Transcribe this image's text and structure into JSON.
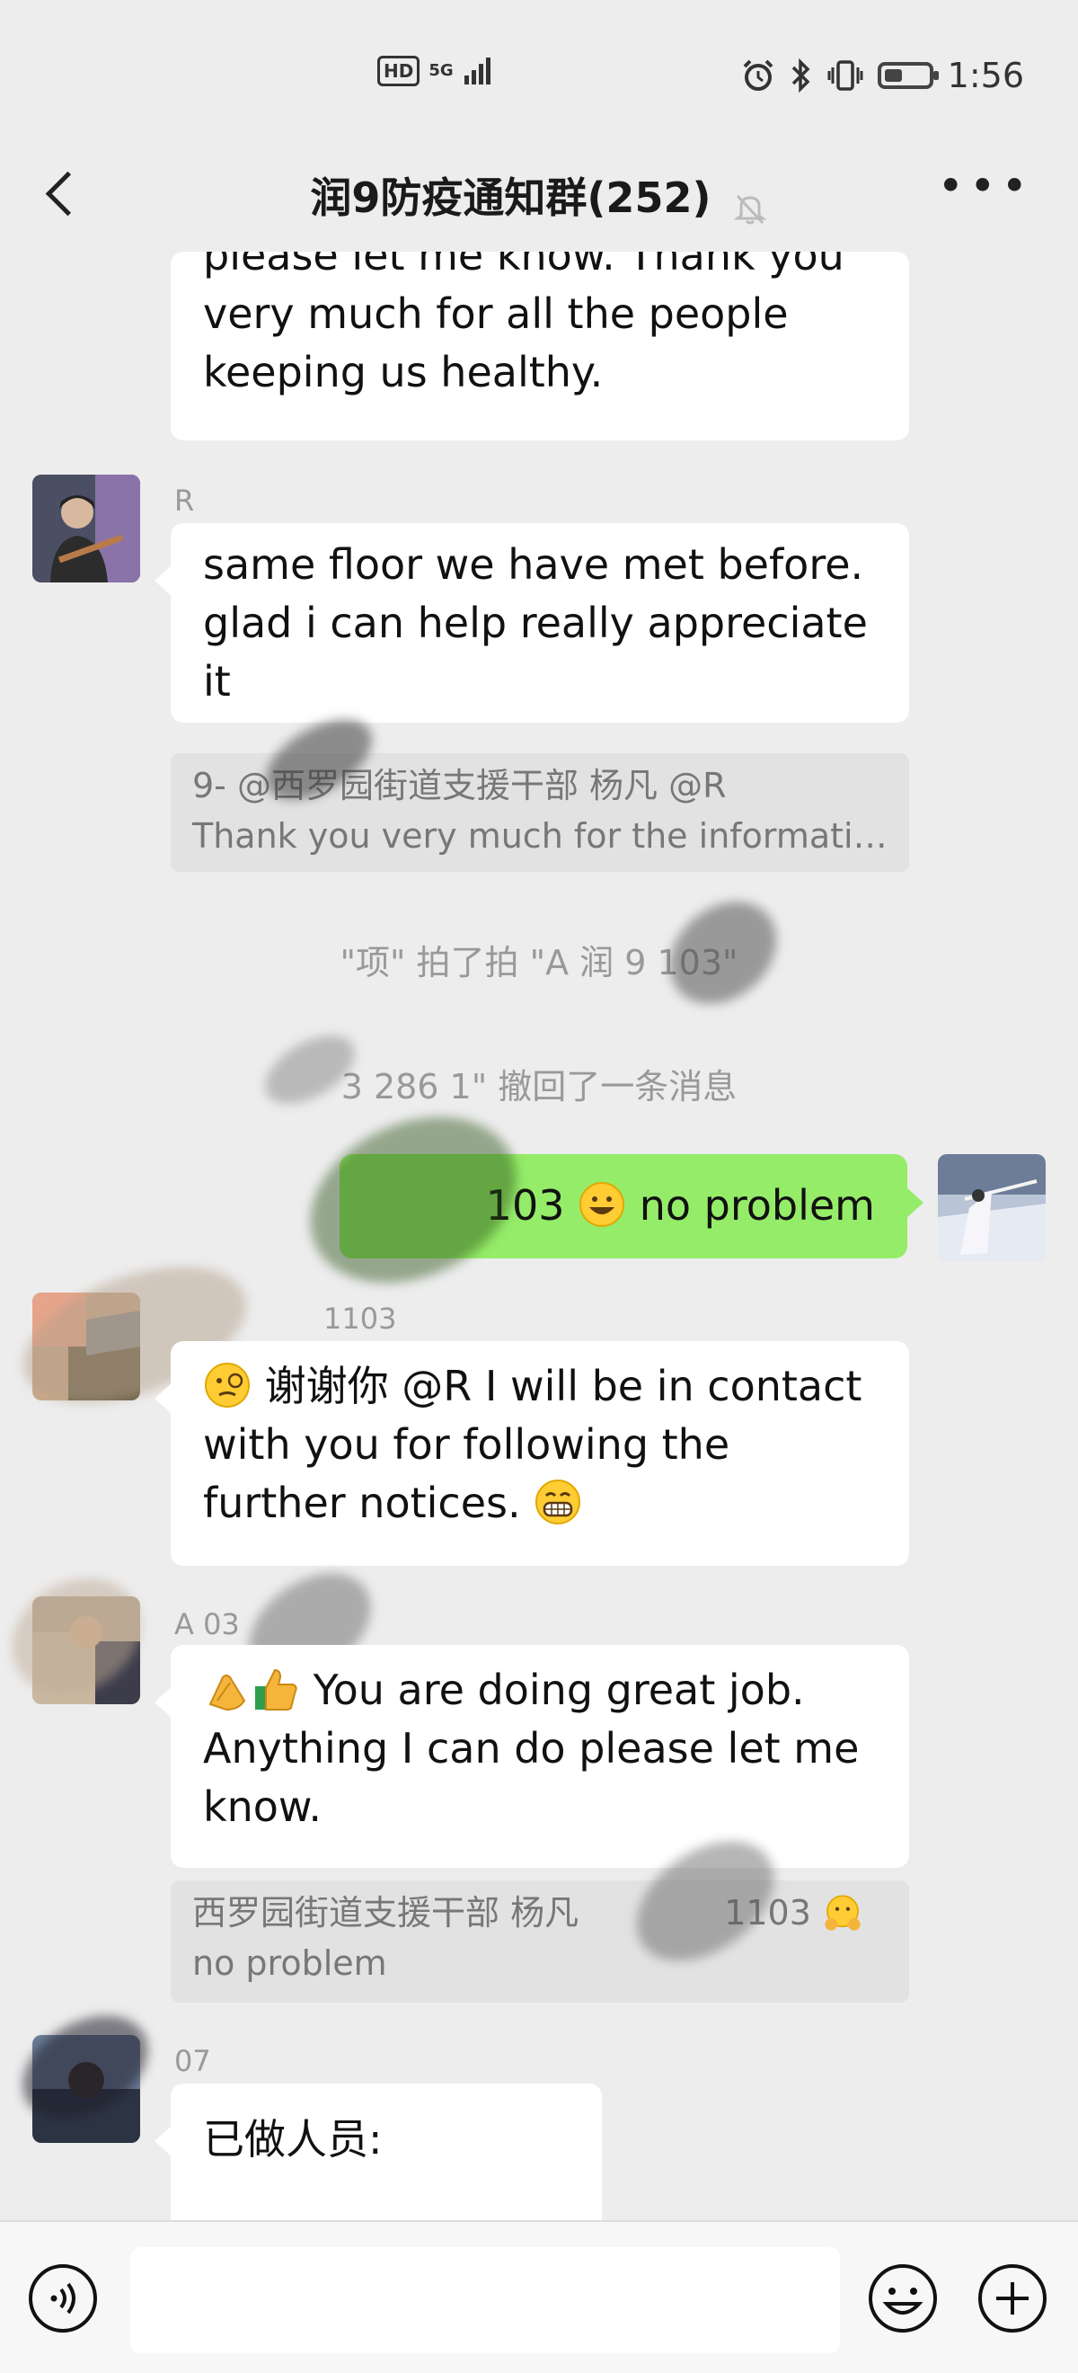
{
  "status_bar": {
    "hd": "HD",
    "network": "5G",
    "time": "1:56",
    "icons": [
      "alarm-icon",
      "bluetooth-icon",
      "vibrate-icon",
      "battery-icon"
    ],
    "battery_level": 0.35
  },
  "header": {
    "title": "润9防疫通知群(252)",
    "icons": [
      "back-icon",
      "mute-icon",
      "more-icon"
    ]
  },
  "messages": {
    "m1": {
      "lines": [
        "please let me know. Thank you",
        "very much for all the people",
        "keeping us healthy."
      ]
    },
    "m2": {
      "sender": "R",
      "lines": [
        "same floor we have met before.",
        "glad i can help really appreciate",
        "it"
      ]
    },
    "q1": {
      "line1": "9-         @西罗园街道支援干部 杨凡 @R",
      "line2": "Thank you very much for the informati…"
    },
    "sys1": "\"项\" 拍了拍 \"A    润 9      103\"",
    "sys2": "3            286 1\" 撤回了一条消息",
    "m3": {
      "prefix": "103",
      "text": "no problem",
      "emoji": "grinning-face-emoji"
    },
    "m4": {
      "sender": "1103",
      "line1": "谢谢你 @R I will be in contact",
      "line2": "with you for following the",
      "line3": "further notices.",
      "emojis": [
        "monocle-face-emoji",
        "grimacing-face-emoji"
      ]
    },
    "m5": {
      "sender": "A         03",
      "line1": "You are doing great job.",
      "line2": "Anything I can do please let me",
      "line3": "know.",
      "emojis": [
        "clapping-hands-emoji",
        "thumbs-up-emoji"
      ]
    },
    "q2": {
      "line1": "西罗园街道支援干部 杨凡",
      "line1_tail": "1103",
      "line2": "no problem"
    },
    "m6": {
      "sender": "         07",
      "text": "已做人员:"
    }
  },
  "input_bar": {
    "placeholder": "",
    "icons": [
      "voice-icon",
      "emoji-icon",
      "add-icon"
    ]
  },
  "colors": {
    "background": "#ededed",
    "bubble_self": "#95ec69",
    "bubble_other": "#ffffff",
    "quote_bg": "#e2e2e2"
  }
}
